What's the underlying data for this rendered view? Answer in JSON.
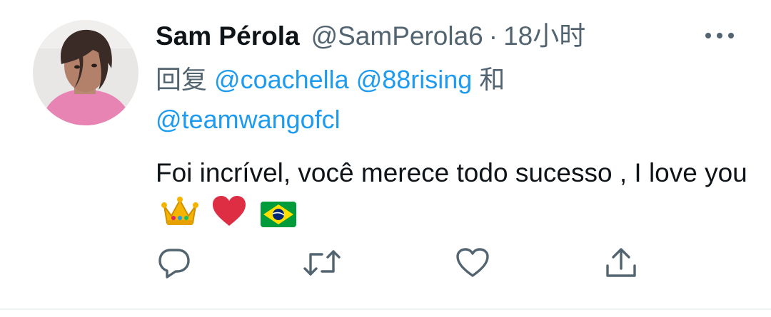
{
  "tweet": {
    "display_name": "Sam Pérola",
    "handle": "@SamPerola6",
    "separator": "·",
    "time": "18小时",
    "reply_prefix": "回复",
    "reply_mentions": [
      "@coachella",
      "@88rising",
      "@teamwangofcl"
    ],
    "reply_joiner": "和",
    "text": "Foi incrível, você merece todo sucesso , I love you",
    "text_emojis": [
      "crown-emoji",
      "red-heart-emoji",
      "brazil-flag-emoji"
    ]
  },
  "actions": [
    "reply-icon",
    "retweet-icon",
    "like-icon",
    "share-icon"
  ],
  "colors": {
    "text": "#0f1419",
    "secondary": "#536471",
    "link": "#1d9bf0",
    "divider": "#eff3f4"
  }
}
